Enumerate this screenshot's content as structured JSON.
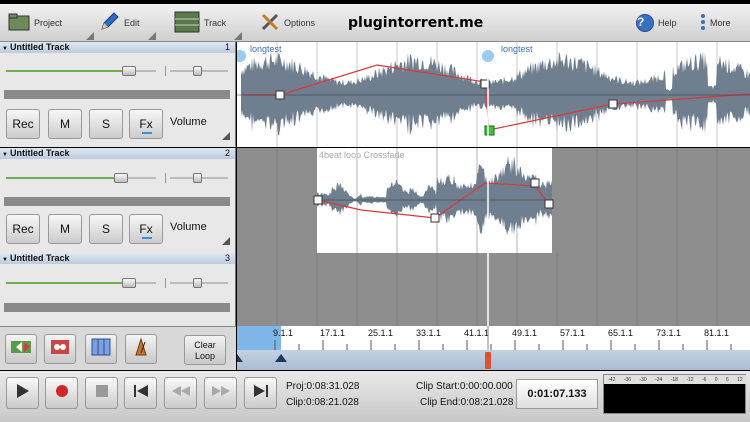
{
  "toolbar": {
    "project": "Project",
    "edit": "Edit",
    "track": "Track",
    "options": "Options",
    "help": "Help",
    "help_glyph": "?",
    "more": "More",
    "watermark": "plugintorrent.me"
  },
  "tracks": [
    {
      "name": "Untitled Track",
      "number": "1",
      "rec": "Rec",
      "mute": "M",
      "solo": "S",
      "fx": "Fx",
      "volume": "Volume",
      "clips": [
        "longtest",
        "longtest"
      ]
    },
    {
      "name": "Untitled Track",
      "number": "2",
      "rec": "Rec",
      "mute": "M",
      "solo": "S",
      "fx": "Fx",
      "volume": "Volume",
      "clips": [
        "4beat loop Crossfade"
      ]
    },
    {
      "name": "Untitled Track",
      "number": "3"
    }
  ],
  "tools": {
    "clear_loop_line1": "Clear",
    "clear_loop_line2": "Loop"
  },
  "ruler": {
    "labels": [
      "9.1.1",
      "17.1.1",
      "25.1.1",
      "33.1.1",
      "41.1.1",
      "49.1.1",
      "57.1.1",
      "65.1.1",
      "73.1.1",
      "81.1.1"
    ]
  },
  "transport": {
    "proj": "Proj:0:08:31.028",
    "clip": "Clip:0:08:21.028",
    "clip_start": "Clip Start:0:00:00.000",
    "clip_end": "Clip End:0:08:21.028",
    "time": "0:01:07.133"
  },
  "meter": {
    "scale": [
      "-42",
      "-36",
      "-30",
      "-24",
      "-18",
      "-12",
      "-6",
      "0",
      "6",
      "12"
    ]
  },
  "colors": {
    "accent": "#3a6fc2",
    "waveform": "#6f7f8f",
    "envelope": "#d63a3a",
    "playhead": "#e05030"
  }
}
